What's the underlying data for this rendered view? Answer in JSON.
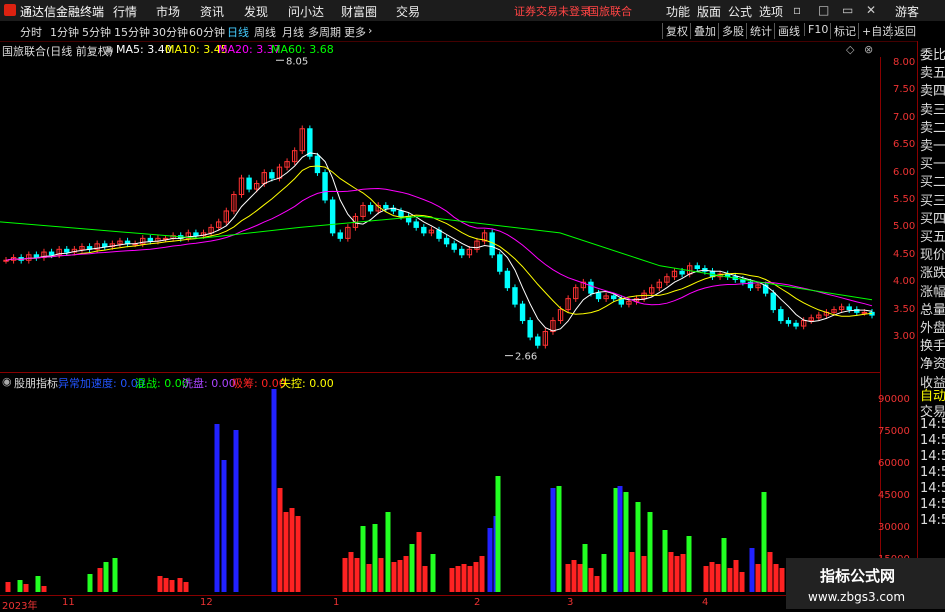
{
  "app": {
    "title": "通达信金融终端"
  },
  "menu": [
    "行情",
    "市场",
    "资讯",
    "发现",
    "问小达",
    "财富圈",
    "交易"
  ],
  "menu_alert": {
    "trade_status": "证券交易未登录",
    "stock": "国旅联合"
  },
  "menu_right": [
    "功能",
    "版面",
    "公式",
    "选项"
  ],
  "user": "游客",
  "timeframes": [
    "分时",
    "1分钟",
    "5分钟",
    "15分钟",
    "30分钟",
    "60分钟",
    "日线",
    "周线",
    "月线",
    "多周期",
    "更多"
  ],
  "active_timeframe_index": 6,
  "toolbar_right": [
    "复权",
    "叠加",
    "多股",
    "统计",
    "画线",
    "F10",
    "标记",
    "+自选",
    "返回"
  ],
  "stock_header": "国旅联合(日线 前复权)",
  "ma": [
    {
      "label": "MA5:",
      "value": "3.40",
      "color": "#ffffff"
    },
    {
      "label": "MA10:",
      "value": "3.45",
      "color": "#ffff00"
    },
    {
      "label": "MA20:",
      "value": "3.37",
      "color": "#ff00ff"
    },
    {
      "label": "MA60:",
      "value": "3.68",
      "color": "#00ff00"
    }
  ],
  "price_axis": [
    "8.00",
    "7.50",
    "7.00",
    "6.50",
    "6.00",
    "5.50",
    "5.00",
    "4.50",
    "4.00",
    "3.50",
    "3.00"
  ],
  "price_high": "8.05",
  "price_low": "2.66",
  "indicator": {
    "name": "股朋指标",
    "items": [
      {
        "label": "异常加速度:",
        "value": "0.00",
        "color": "#2255ff"
      },
      {
        "label": "混战:",
        "value": "0.00",
        "color": "#00ff00"
      },
      {
        "label": "洗盘:",
        "value": "0.00",
        "color": "#aa44ff"
      },
      {
        "label": "吸筹:",
        "value": "0.00",
        "color": "#ff2222"
      },
      {
        "label": "失控:",
        "value": "0.00",
        "color": "#ffff00"
      }
    ],
    "axis": [
      "90000",
      "75000",
      "60000",
      "45000",
      "30000",
      "15000"
    ]
  },
  "x_labels": [
    "2023年",
    "11",
    "12",
    "1",
    "2",
    "3",
    "4"
  ],
  "right_panel": [
    "委比",
    "卖五",
    "卖四",
    "卖三",
    "卖二",
    "卖一",
    "买一",
    "买二",
    "买三",
    "买四",
    "买五",
    "现价",
    "涨跌",
    "涨幅",
    "总量",
    "外盘",
    "换手",
    "净资",
    "收益"
  ],
  "right_panel_lower": [
    "自动",
    "交易",
    "14:56",
    "14:56",
    "14:56",
    "14:56",
    "14:56",
    "14:56",
    "14:56"
  ],
  "watermark": {
    "title": "指标公式网",
    "url": "www.zbgs3.com"
  }
}
